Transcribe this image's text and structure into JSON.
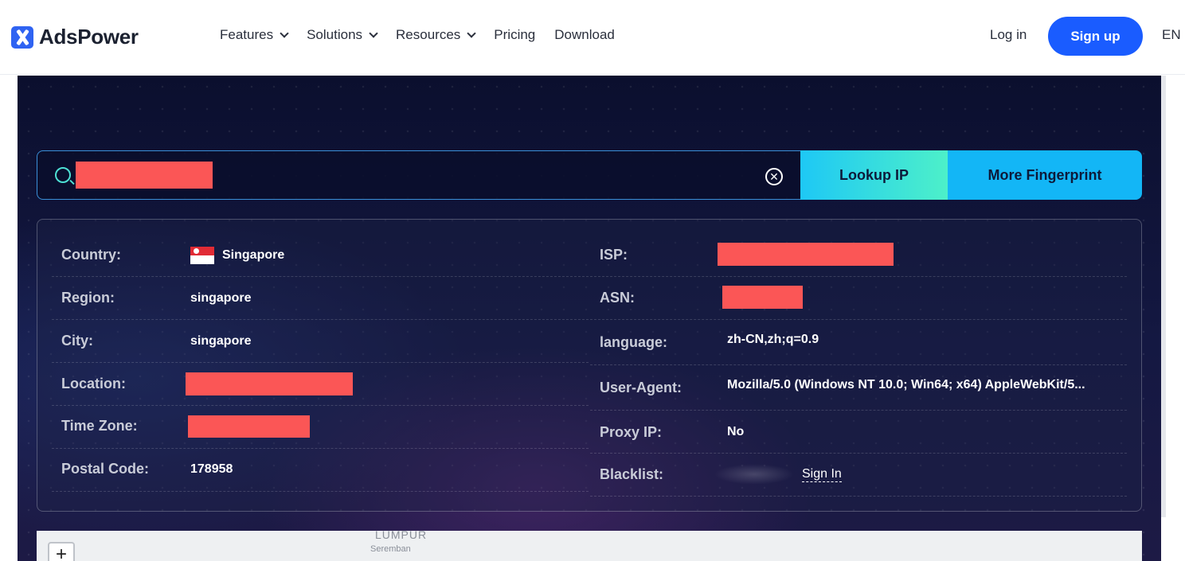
{
  "header": {
    "logo_text": "AdsPower",
    "nav": [
      {
        "label": "Features",
        "dropdown": true
      },
      {
        "label": "Solutions",
        "dropdown": true
      },
      {
        "label": "Resources",
        "dropdown": true
      },
      {
        "label": "Pricing",
        "dropdown": false
      },
      {
        "label": "Download",
        "dropdown": false
      }
    ],
    "login": "Log in",
    "signup": "Sign up",
    "language": "EN"
  },
  "search": {
    "value": "",
    "lookup_label": "Lookup IP",
    "more_label": "More Fingerprint"
  },
  "info": {
    "left": [
      {
        "label": "Country:",
        "value": "Singapore"
      },
      {
        "label": "Region:",
        "value": "singapore"
      },
      {
        "label": "City:",
        "value": "singapore"
      },
      {
        "label": "Location:",
        "value": ""
      },
      {
        "label": "Time Zone:",
        "value": ""
      },
      {
        "label": "Postal Code:",
        "value": "178958"
      }
    ],
    "right": [
      {
        "label": "ISP:",
        "value": ""
      },
      {
        "label": "ASN:",
        "value": ""
      },
      {
        "label": "language:",
        "value": "zh-CN,zh;q=0.9"
      },
      {
        "label": "User-Agent:",
        "value": "Mozilla/5.0 (Windows NT 10.0; Win64; x64) AppleWebKit/5..."
      },
      {
        "label": "Proxy IP:",
        "value": "No"
      },
      {
        "label": "Blacklist:",
        "value": "Sign In"
      }
    ]
  },
  "map": {
    "zoom_in": "+",
    "label_1": "LUMPUR",
    "label_2": "Seremban"
  },
  "colors": {
    "accent_blue": "#1a5cff",
    "lookup_gradient_start": "#1ec8f5",
    "lookup_gradient_end": "#4df0c9",
    "redaction": "#fb5656"
  }
}
